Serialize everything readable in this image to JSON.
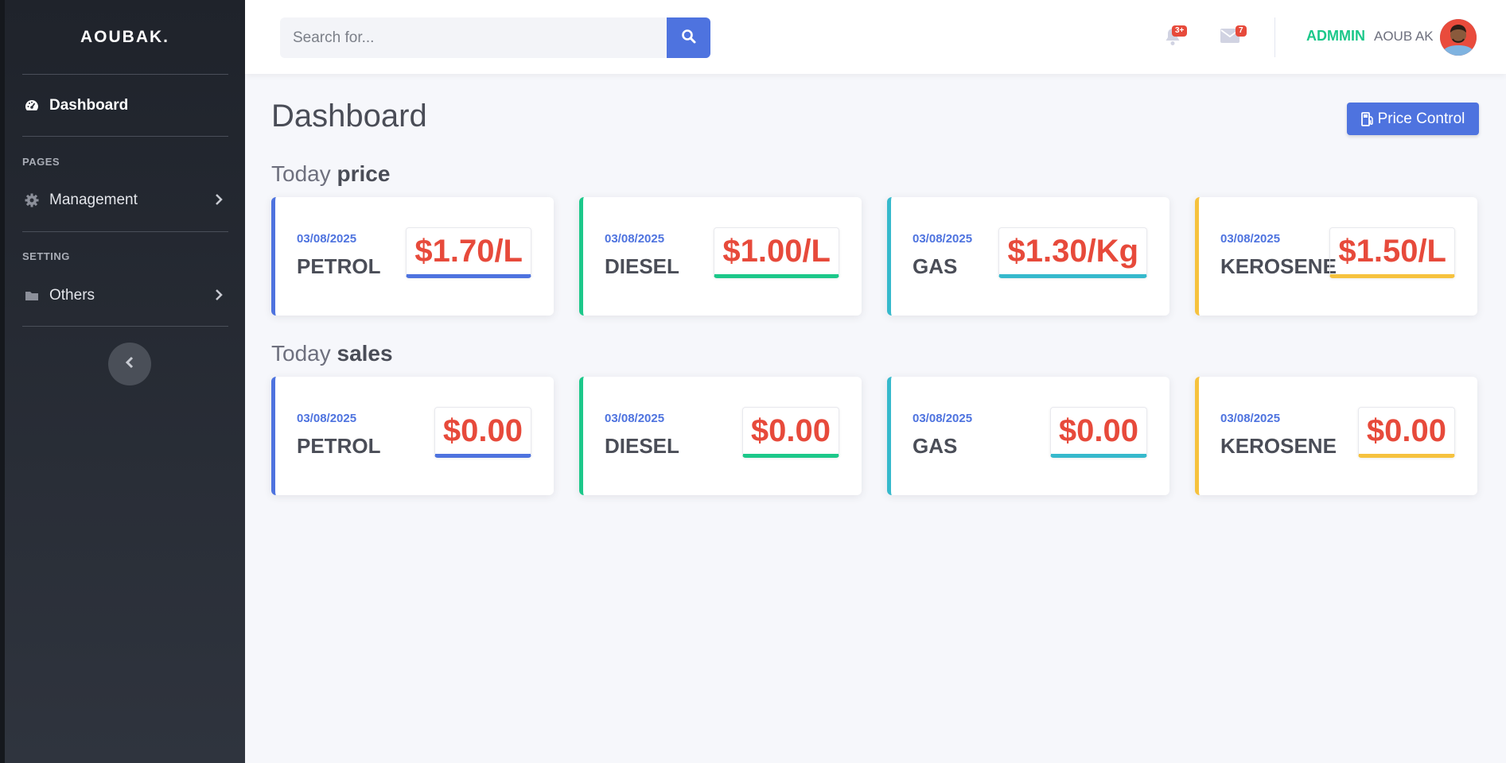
{
  "sidebar": {
    "brand": "AOUBAK.",
    "dashboard_label": "Dashboard",
    "pages_heading": "PAGES",
    "management_label": "Management",
    "setting_heading": "SETTING",
    "others_label": "Others"
  },
  "topbar": {
    "search_placeholder": "Search for...",
    "notifications_badge": "3+",
    "messages_badge": "7",
    "user_role": "ADMMIN",
    "user_name": "AOUB AK"
  },
  "main": {
    "title": "Dashboard",
    "price_control_label": "Price Control",
    "price_section": {
      "prefix": "Today",
      "bold": "price"
    },
    "sales_section": {
      "prefix": "Today",
      "bold": "sales"
    },
    "price_cards": [
      {
        "date": "03/08/2025",
        "fuel": "PETROL",
        "value": "$1.70/L",
        "accent": "#4e73df"
      },
      {
        "date": "03/08/2025",
        "fuel": "DIESEL",
        "value": "$1.00/L",
        "accent": "#1cc88a"
      },
      {
        "date": "03/08/2025",
        "fuel": "GAS",
        "value": "$1.30/Kg",
        "accent": "#36b9cc"
      },
      {
        "date": "03/08/2025",
        "fuel": "KEROSENE",
        "value": "$1.50/L",
        "accent": "#f6c23e"
      }
    ],
    "sales_cards": [
      {
        "date": "03/08/2025",
        "fuel": "PETROL",
        "value": "$0.00",
        "accent": "#4e73df"
      },
      {
        "date": "03/08/2025",
        "fuel": "DIESEL",
        "value": "$0.00",
        "accent": "#1cc88a"
      },
      {
        "date": "03/08/2025",
        "fuel": "GAS",
        "value": "$0.00",
        "accent": "#36b9cc"
      },
      {
        "date": "03/08/2025",
        "fuel": "KEROSENE",
        "value": "$0.00",
        "accent": "#f6c23e"
      }
    ]
  },
  "colors": {
    "primary": "#4e73df",
    "success": "#1cc88a",
    "info": "#36b9cc",
    "warning": "#f6c23e",
    "danger": "#e74a3b"
  },
  "icons": {
    "dashboard": "tachometer-icon",
    "management": "gear-icon",
    "others": "folder-icon",
    "search": "search-icon",
    "notifications": "bell-icon",
    "messages": "envelope-icon",
    "price_control": "gas-pump-icon",
    "sidebar_toggle": "chevron-left-icon"
  }
}
